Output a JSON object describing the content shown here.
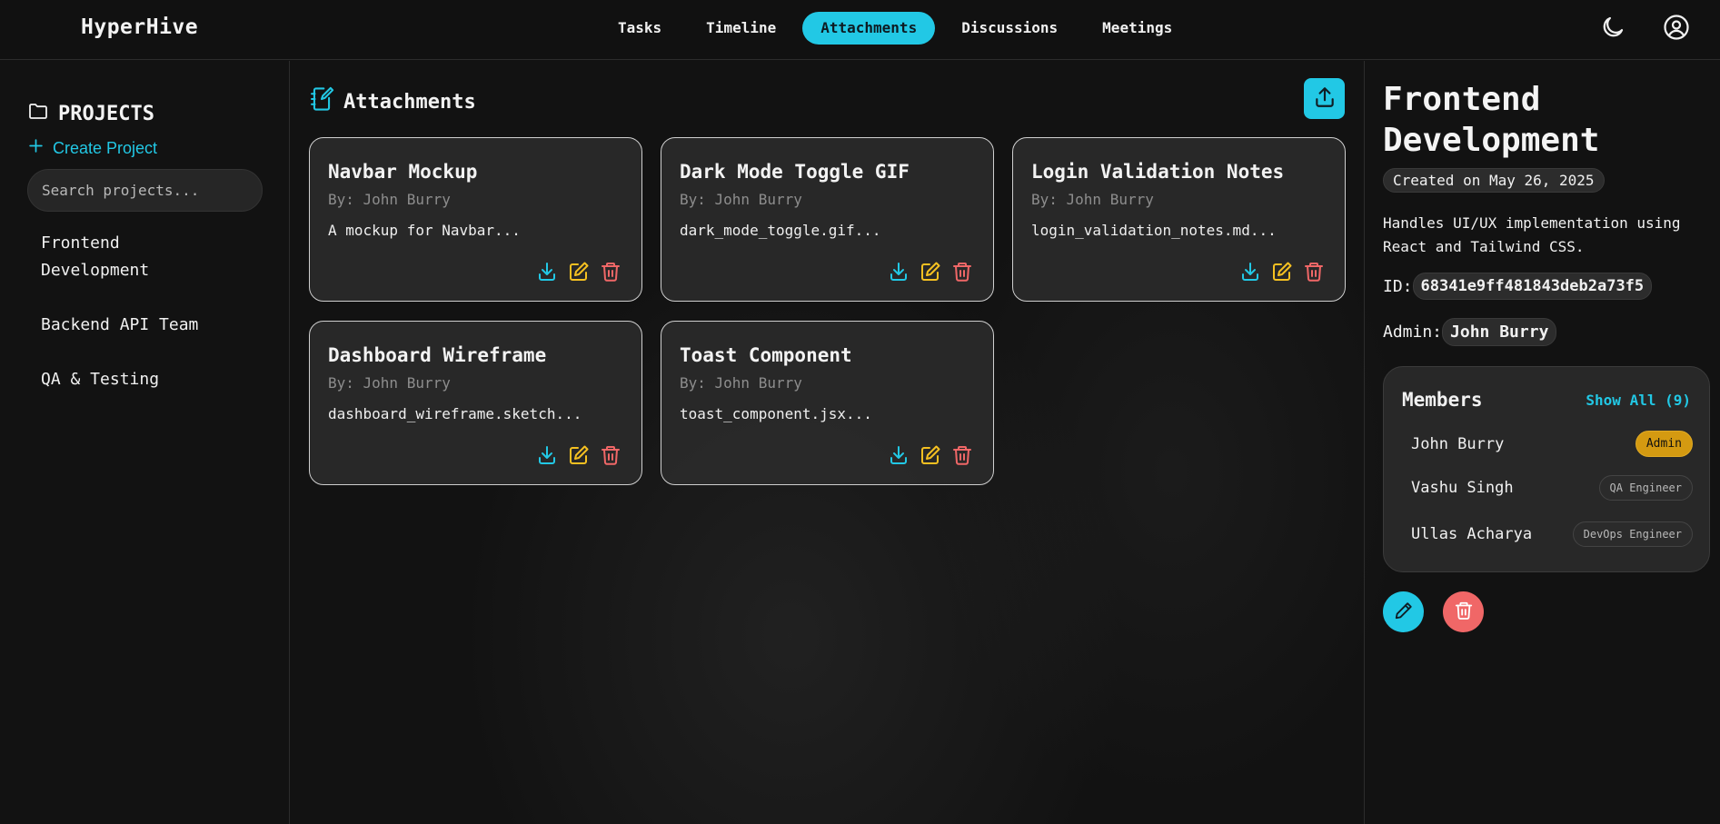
{
  "app": {
    "brand": "HyperHive"
  },
  "nav": {
    "items": [
      {
        "label": "Tasks"
      },
      {
        "label": "Timeline"
      },
      {
        "label": "Attachments",
        "active": true
      },
      {
        "label": "Discussions"
      },
      {
        "label": "Meetings"
      }
    ],
    "icons": [
      "moon-icon",
      "user-circle-icon"
    ]
  },
  "sidebar": {
    "heading": "PROJECTS",
    "create_label": "Create Project",
    "search_placeholder": "Search projects...",
    "projects": [
      {
        "name": "Frontend Development"
      },
      {
        "name": "Backend API Team"
      },
      {
        "name": "QA & Testing"
      }
    ]
  },
  "main": {
    "heading": "Attachments",
    "attachments": [
      {
        "title": "Navbar Mockup",
        "by": "By: John Burry",
        "desc": "A mockup for Navbar..."
      },
      {
        "title": "Dark Mode Toggle GIF",
        "by": "By: John Burry",
        "desc": "dark_mode_toggle.gif..."
      },
      {
        "title": "Login Validation Notes",
        "by": "By: John Burry",
        "desc": "login_validation_notes.md..."
      },
      {
        "title": "Dashboard Wireframe",
        "by": "By: John Burry",
        "desc": "dashboard_wireframe.sketch..."
      },
      {
        "title": "Toast Component",
        "by": "By: John Burry",
        "desc": "toast_component.jsx..."
      }
    ]
  },
  "details": {
    "title": "Frontend Development",
    "created": "Created on May 26, 2025",
    "description": "Handles UI/UX implementation using React and Tailwind CSS.",
    "id_label": "ID:",
    "id_value": "68341e9ff481843deb2a73f5",
    "admin_label": "Admin:",
    "admin_value": "John Burry",
    "members_heading": "Members",
    "show_all": "Show All (9)",
    "members": [
      {
        "name": "John Burry",
        "role": "Admin"
      },
      {
        "name": "Vashu Singh",
        "role": "QA Engineer"
      },
      {
        "name": "Ullas Acharya",
        "role": "DevOps Engineer"
      }
    ]
  },
  "colors": {
    "accent": "#22c8e5",
    "download": "#22c8e5",
    "edit": "#f5c021",
    "delete": "#f06767",
    "admin_badge": "#d49a11"
  }
}
